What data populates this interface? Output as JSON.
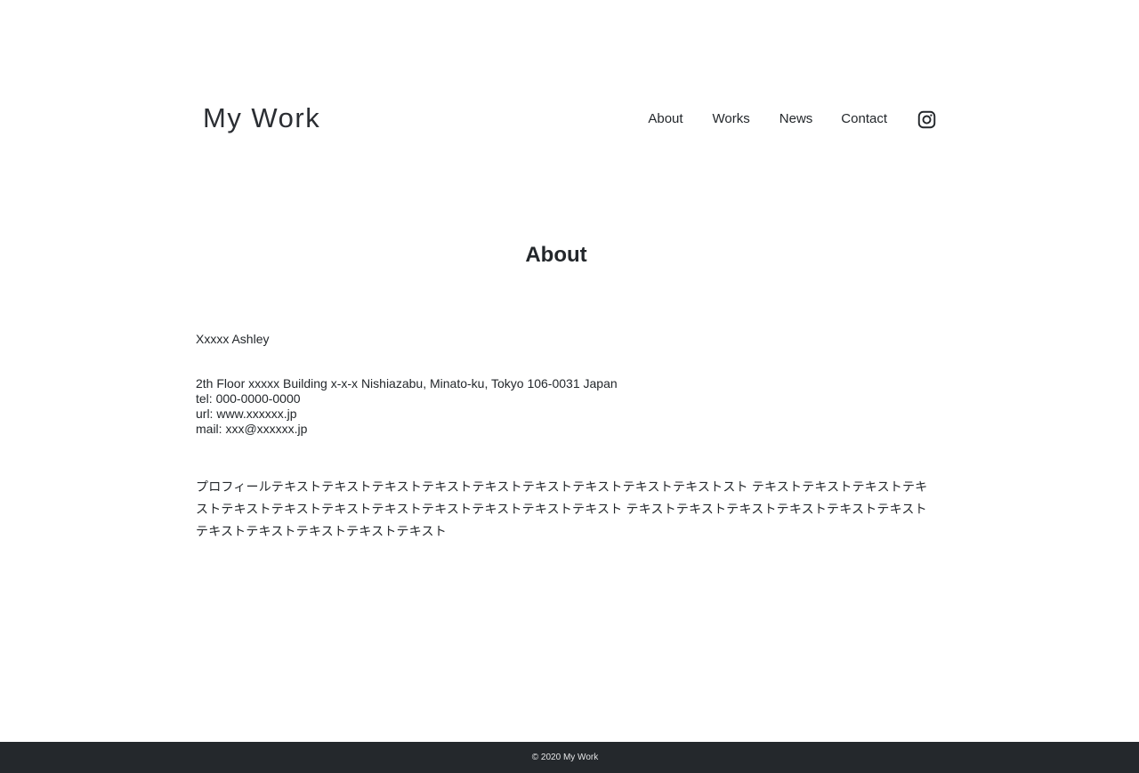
{
  "header": {
    "logo": "My Work",
    "nav": [
      "About",
      "Works",
      "News",
      "Contact"
    ],
    "social_icon": "instagram-icon"
  },
  "main": {
    "title": "About",
    "name": "Xxxxx Ashley",
    "address": "2th Floor xxxxx Building x-x-x Nishiazabu, Minato-ku, Tokyo 106-0031 Japan",
    "tel": "tel: 000-0000-0000",
    "url": "url: www.xxxxxx.jp",
    "mail": "mail: xxx@xxxxxx.jp",
    "profile": "プロフィールテキストテキストテキストテキストテキストテキストテキストテキストテキストスト テキストテキストテキストテキストテキストテキストテキストテキストテキストテキストテキストテキスト テキストテキストテキストテキストテキストテキストテキストテキストテキストテキストテキスト"
  },
  "footer": {
    "copyright": "© 2020 My Work"
  },
  "colors": {
    "text": "#23272b",
    "footer_bg": "#24282c",
    "footer_text": "#e6e7e8"
  }
}
